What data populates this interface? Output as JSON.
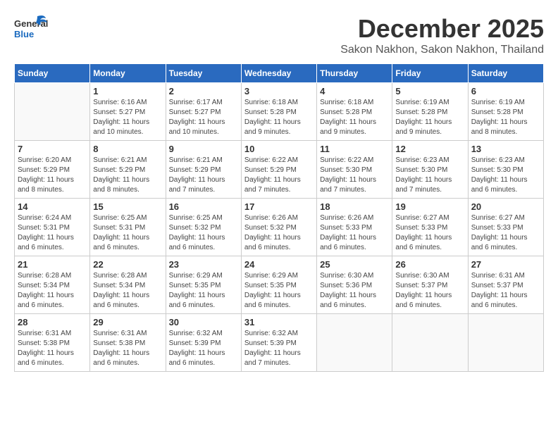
{
  "header": {
    "logo_general": "General",
    "logo_blue": "Blue",
    "month": "December 2025",
    "location": "Sakon Nakhon, Sakon Nakhon, Thailand"
  },
  "days_of_week": [
    "Sunday",
    "Monday",
    "Tuesday",
    "Wednesday",
    "Thursday",
    "Friday",
    "Saturday"
  ],
  "weeks": [
    [
      {
        "day": "",
        "info": ""
      },
      {
        "day": "1",
        "info": "Sunrise: 6:16 AM\nSunset: 5:27 PM\nDaylight: 11 hours\nand 10 minutes."
      },
      {
        "day": "2",
        "info": "Sunrise: 6:17 AM\nSunset: 5:27 PM\nDaylight: 11 hours\nand 10 minutes."
      },
      {
        "day": "3",
        "info": "Sunrise: 6:18 AM\nSunset: 5:28 PM\nDaylight: 11 hours\nand 9 minutes."
      },
      {
        "day": "4",
        "info": "Sunrise: 6:18 AM\nSunset: 5:28 PM\nDaylight: 11 hours\nand 9 minutes."
      },
      {
        "day": "5",
        "info": "Sunrise: 6:19 AM\nSunset: 5:28 PM\nDaylight: 11 hours\nand 9 minutes."
      },
      {
        "day": "6",
        "info": "Sunrise: 6:19 AM\nSunset: 5:28 PM\nDaylight: 11 hours\nand 8 minutes."
      }
    ],
    [
      {
        "day": "7",
        "info": "Sunrise: 6:20 AM\nSunset: 5:29 PM\nDaylight: 11 hours\nand 8 minutes."
      },
      {
        "day": "8",
        "info": "Sunrise: 6:21 AM\nSunset: 5:29 PM\nDaylight: 11 hours\nand 8 minutes."
      },
      {
        "day": "9",
        "info": "Sunrise: 6:21 AM\nSunset: 5:29 PM\nDaylight: 11 hours\nand 7 minutes."
      },
      {
        "day": "10",
        "info": "Sunrise: 6:22 AM\nSunset: 5:29 PM\nDaylight: 11 hours\nand 7 minutes."
      },
      {
        "day": "11",
        "info": "Sunrise: 6:22 AM\nSunset: 5:30 PM\nDaylight: 11 hours\nand 7 minutes."
      },
      {
        "day": "12",
        "info": "Sunrise: 6:23 AM\nSunset: 5:30 PM\nDaylight: 11 hours\nand 7 minutes."
      },
      {
        "day": "13",
        "info": "Sunrise: 6:23 AM\nSunset: 5:30 PM\nDaylight: 11 hours\nand 6 minutes."
      }
    ],
    [
      {
        "day": "14",
        "info": "Sunrise: 6:24 AM\nSunset: 5:31 PM\nDaylight: 11 hours\nand 6 minutes."
      },
      {
        "day": "15",
        "info": "Sunrise: 6:25 AM\nSunset: 5:31 PM\nDaylight: 11 hours\nand 6 minutes."
      },
      {
        "day": "16",
        "info": "Sunrise: 6:25 AM\nSunset: 5:32 PM\nDaylight: 11 hours\nand 6 minutes."
      },
      {
        "day": "17",
        "info": "Sunrise: 6:26 AM\nSunset: 5:32 PM\nDaylight: 11 hours\nand 6 minutes."
      },
      {
        "day": "18",
        "info": "Sunrise: 6:26 AM\nSunset: 5:33 PM\nDaylight: 11 hours\nand 6 minutes."
      },
      {
        "day": "19",
        "info": "Sunrise: 6:27 AM\nSunset: 5:33 PM\nDaylight: 11 hours\nand 6 minutes."
      },
      {
        "day": "20",
        "info": "Sunrise: 6:27 AM\nSunset: 5:33 PM\nDaylight: 11 hours\nand 6 minutes."
      }
    ],
    [
      {
        "day": "21",
        "info": "Sunrise: 6:28 AM\nSunset: 5:34 PM\nDaylight: 11 hours\nand 6 minutes."
      },
      {
        "day": "22",
        "info": "Sunrise: 6:28 AM\nSunset: 5:34 PM\nDaylight: 11 hours\nand 6 minutes."
      },
      {
        "day": "23",
        "info": "Sunrise: 6:29 AM\nSunset: 5:35 PM\nDaylight: 11 hours\nand 6 minutes."
      },
      {
        "day": "24",
        "info": "Sunrise: 6:29 AM\nSunset: 5:35 PM\nDaylight: 11 hours\nand 6 minutes."
      },
      {
        "day": "25",
        "info": "Sunrise: 6:30 AM\nSunset: 5:36 PM\nDaylight: 11 hours\nand 6 minutes."
      },
      {
        "day": "26",
        "info": "Sunrise: 6:30 AM\nSunset: 5:37 PM\nDaylight: 11 hours\nand 6 minutes."
      },
      {
        "day": "27",
        "info": "Sunrise: 6:31 AM\nSunset: 5:37 PM\nDaylight: 11 hours\nand 6 minutes."
      }
    ],
    [
      {
        "day": "28",
        "info": "Sunrise: 6:31 AM\nSunset: 5:38 PM\nDaylight: 11 hours\nand 6 minutes."
      },
      {
        "day": "29",
        "info": "Sunrise: 6:31 AM\nSunset: 5:38 PM\nDaylight: 11 hours\nand 6 minutes."
      },
      {
        "day": "30",
        "info": "Sunrise: 6:32 AM\nSunset: 5:39 PM\nDaylight: 11 hours\nand 6 minutes."
      },
      {
        "day": "31",
        "info": "Sunrise: 6:32 AM\nSunset: 5:39 PM\nDaylight: 11 hours\nand 7 minutes."
      },
      {
        "day": "",
        "info": ""
      },
      {
        "day": "",
        "info": ""
      },
      {
        "day": "",
        "info": ""
      }
    ]
  ]
}
